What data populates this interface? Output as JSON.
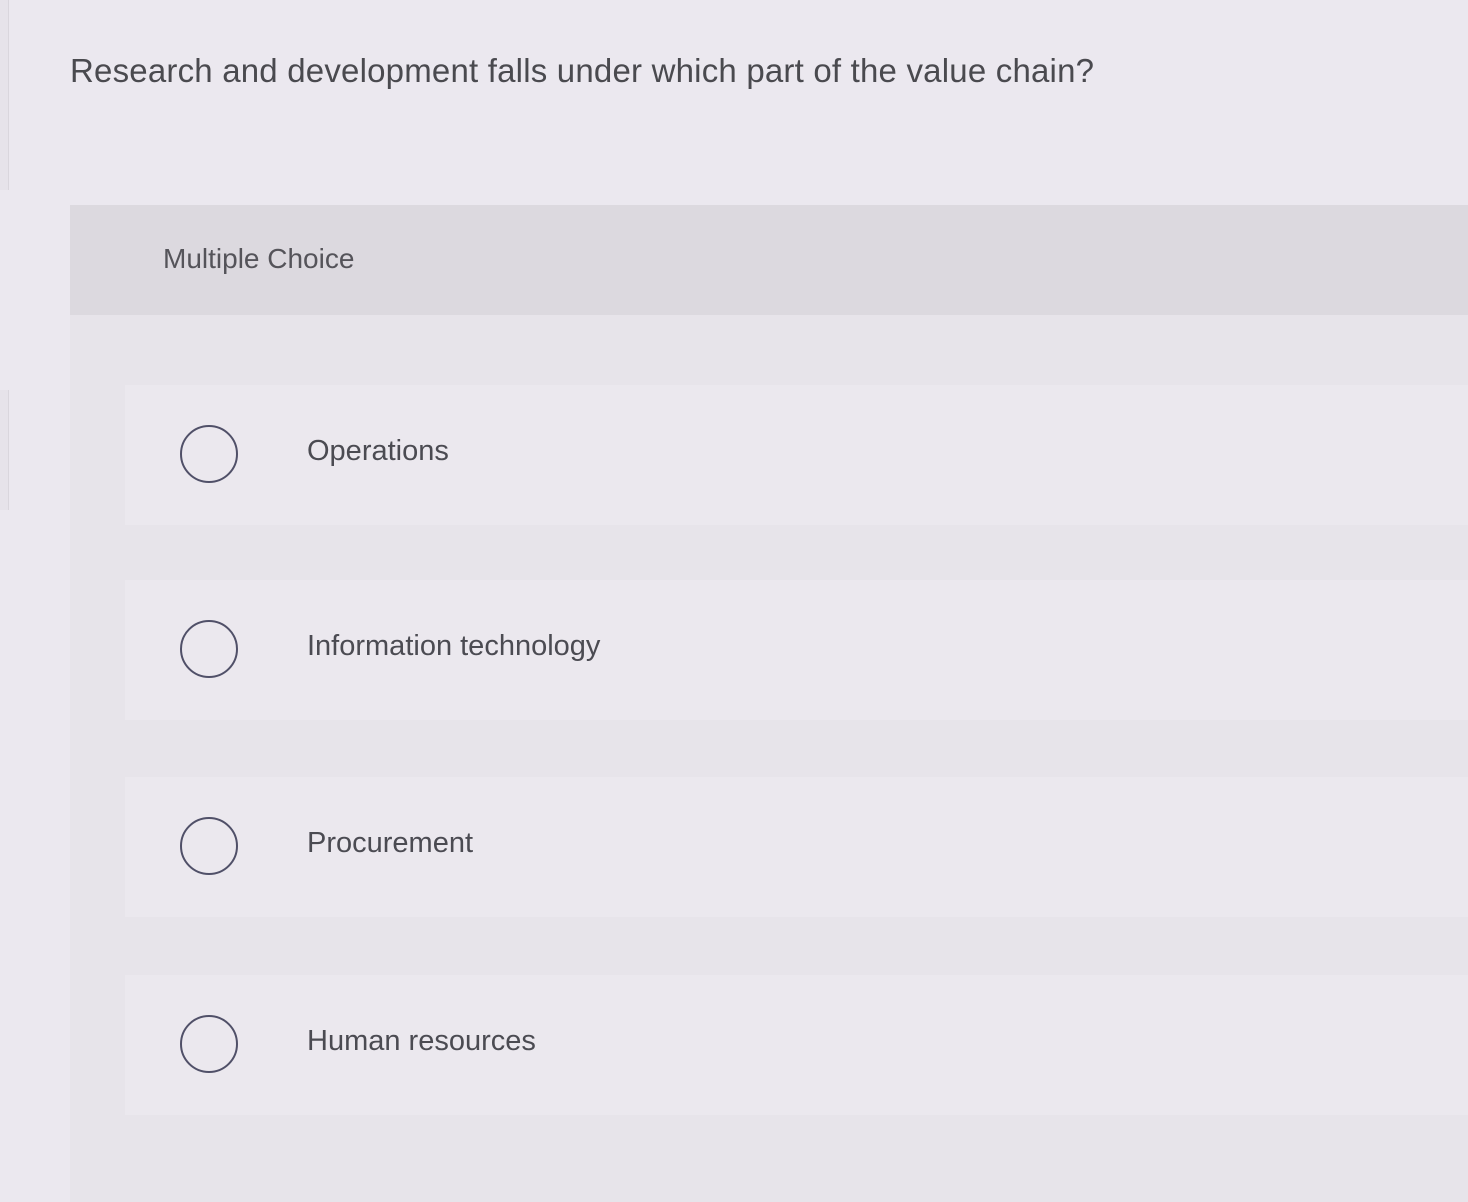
{
  "question": {
    "text": "Research and development falls under which part of the value chain?"
  },
  "panel": {
    "title": "Multiple Choice"
  },
  "choices": [
    {
      "label": "Operations",
      "selected": false,
      "icon": "radio-unchecked-icon"
    },
    {
      "label": "Information technology",
      "selected": false,
      "icon": "radio-unchecked-icon"
    },
    {
      "label": "Procurement",
      "selected": false,
      "icon": "radio-unchecked-icon"
    },
    {
      "label": "Human resources",
      "selected": false,
      "icon": "radio-unchecked-icon"
    }
  ],
  "colors": {
    "background": "#ebe8ef",
    "panel": "#e7e4ea",
    "header": "#dcd9df",
    "text": "#4a4a4f",
    "radio_border": "#505068"
  }
}
